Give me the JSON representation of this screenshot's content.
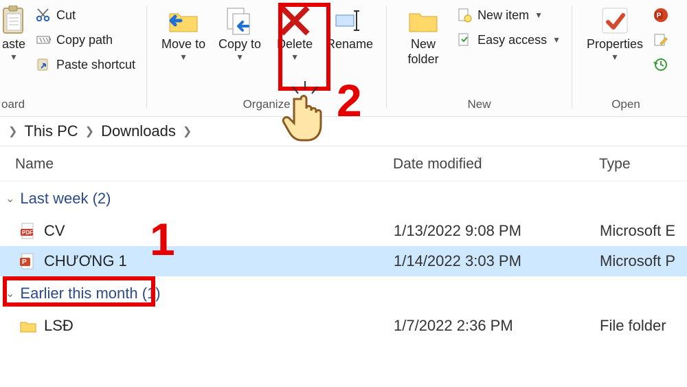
{
  "ribbon": {
    "clipboard": {
      "paste": "aste",
      "cut": "Cut",
      "copy_path": "Copy path",
      "paste_shortcut": "Paste shortcut",
      "group": "oard"
    },
    "organize": {
      "move_to": "Move to",
      "copy_to": "Copy to",
      "delete": "Delete",
      "rename": "Rename",
      "group": "Organize"
    },
    "new": {
      "new_folder": "New folder",
      "new_item": "New item",
      "easy_access": "Easy access",
      "group": "New"
    },
    "open": {
      "properties": "Properties",
      "group": "Open"
    }
  },
  "breadcrumb": {
    "root": "This PC",
    "folder": "Downloads"
  },
  "columns": {
    "name": "Name",
    "date": "Date modified",
    "type": "Type"
  },
  "groups": [
    {
      "label": "Last week (2)"
    },
    {
      "label": "Earlier this month (1)"
    }
  ],
  "files": [
    {
      "name": "CV",
      "date": "1/13/2022 9:08 PM",
      "type": "Microsoft E",
      "icon": "pdf"
    },
    {
      "name": "CHƯƠNG 1",
      "date": "1/14/2022 3:03 PM",
      "type": "Microsoft P",
      "icon": "ppt"
    },
    {
      "name": "LSĐ",
      "date": "1/7/2022 2:36 PM",
      "type": "File folder",
      "icon": "folder"
    }
  ],
  "anno": {
    "one": "1",
    "two": "2"
  }
}
